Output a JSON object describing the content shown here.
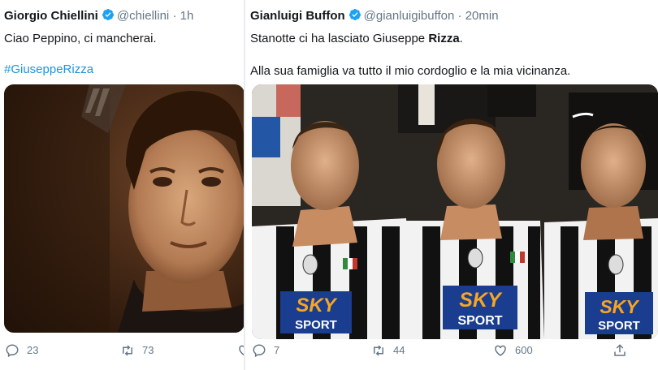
{
  "tweets": [
    {
      "name": "Giorgio Chiellini",
      "handle": "@chiellini",
      "separator": "·",
      "time": "1h",
      "text_line1": "Ciao Peppino, ci mancherai.",
      "hashtag": "#GiuseppeRizza",
      "replies": "23",
      "retweets": "73"
    },
    {
      "name": "Gianluigi Buffon",
      "handle": "@gianluigibuffon",
      "separator": "·",
      "time": "20min",
      "text_line1_prefix": "Stanotte ci ha lasciato Giuseppe ",
      "text_line1_bold": "Rizza",
      "text_line1_suffix": ".",
      "text_line2": "Alla sua famiglia va tutto il mio cordoglio e la mia vicinanza.",
      "replies": "7",
      "retweets": "44",
      "likes": "600",
      "jersey_sponsor_top": "SKY",
      "jersey_sponsor_bottom": "SPORT"
    }
  ],
  "colors": {
    "verified": "#1da1f2",
    "hashtag": "#1b95e0",
    "muted": "#657786",
    "text": "#14171a"
  }
}
